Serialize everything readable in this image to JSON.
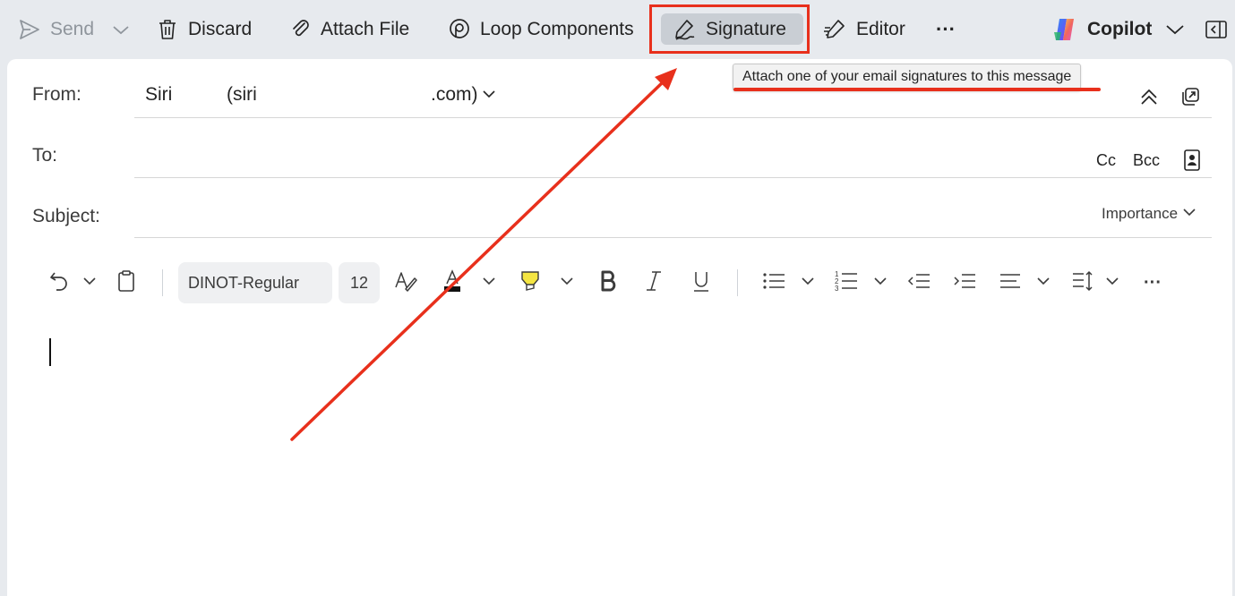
{
  "toolbar": {
    "send_label": "Send",
    "discard_label": "Discard",
    "attach_label": "Attach File",
    "loop_label": "Loop Components",
    "signature_label": "Signature",
    "editor_label": "Editor",
    "more_label": "···",
    "copilot_label": "Copilot"
  },
  "tooltip": {
    "text": "Attach one of your email signatures to this message"
  },
  "compose": {
    "from_label": "From:",
    "from_name": "Siri",
    "from_email_start": "(siri",
    "from_email_end": ".com)",
    "to_label": "To:",
    "cc_label": "Cc",
    "bcc_label": "Bcc",
    "subject_label": "Subject:",
    "importance_label": "Importance"
  },
  "format": {
    "font_name": "DINOT-Regular",
    "font_size": "12",
    "more_label": "···"
  },
  "colors": {
    "annotation_red": "#e8301c",
    "highlight_yellow": "#f4e542"
  }
}
